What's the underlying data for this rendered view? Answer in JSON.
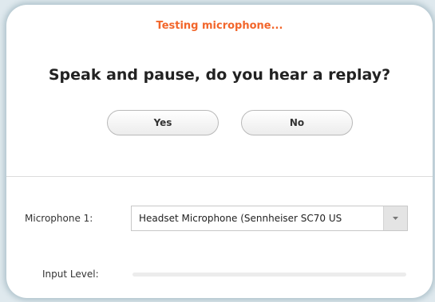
{
  "test": {
    "status": "Testing microphone...",
    "question": "Speak and pause, do you hear a replay?",
    "yes_label": "Yes",
    "no_label": "No"
  },
  "microphone": {
    "label": "Microphone 1:",
    "selected": "Headset Microphone (Sennheiser SC70 US"
  },
  "input_level": {
    "label": "Input Level:",
    "level_percent": 0
  },
  "colors": {
    "status_text": "#f2662b",
    "level_fill": "#2d8cff"
  },
  "icons": {
    "dropdown": "chevron-down-icon"
  }
}
